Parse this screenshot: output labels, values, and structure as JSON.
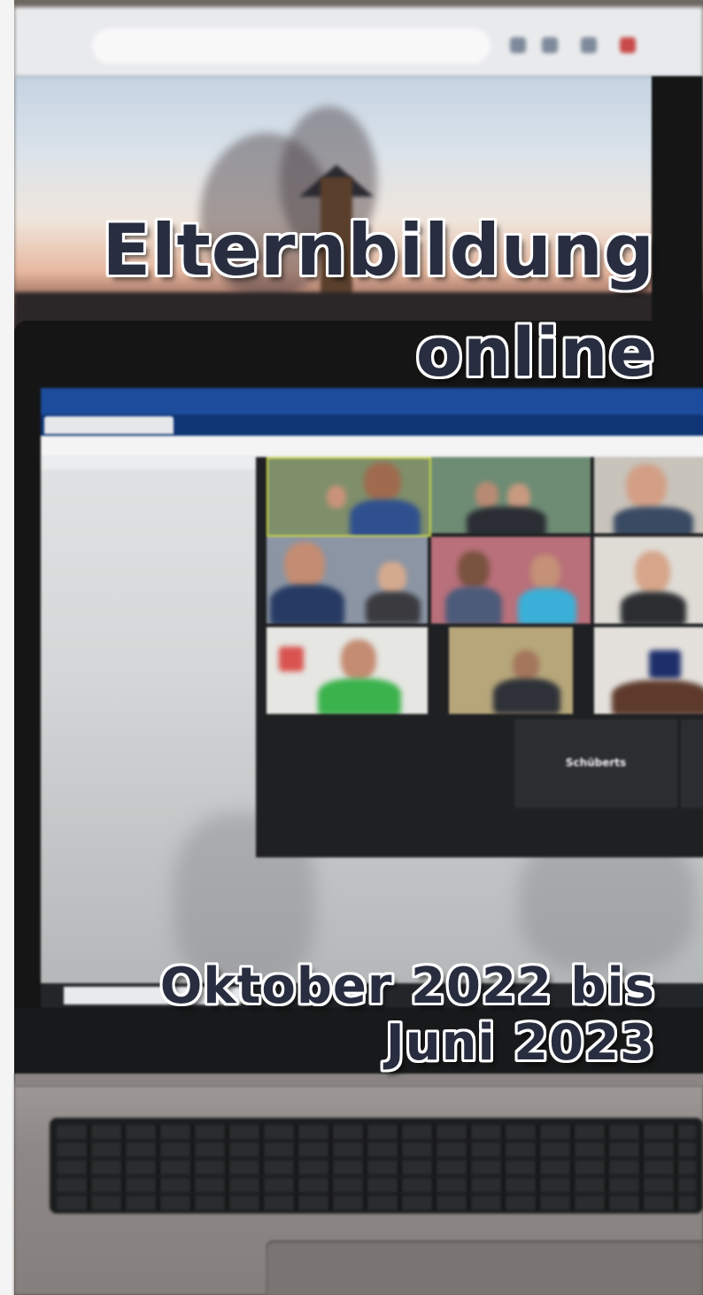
{
  "title": {
    "line1": "Elternbildung",
    "line2": "online"
  },
  "dates": {
    "line1": "Oktober 2022 bis",
    "line2": "Juni 2023"
  },
  "photo": {
    "participant_label": "Schüberts"
  },
  "colors": {
    "text": "#282d40",
    "outline": "#ffffff"
  }
}
